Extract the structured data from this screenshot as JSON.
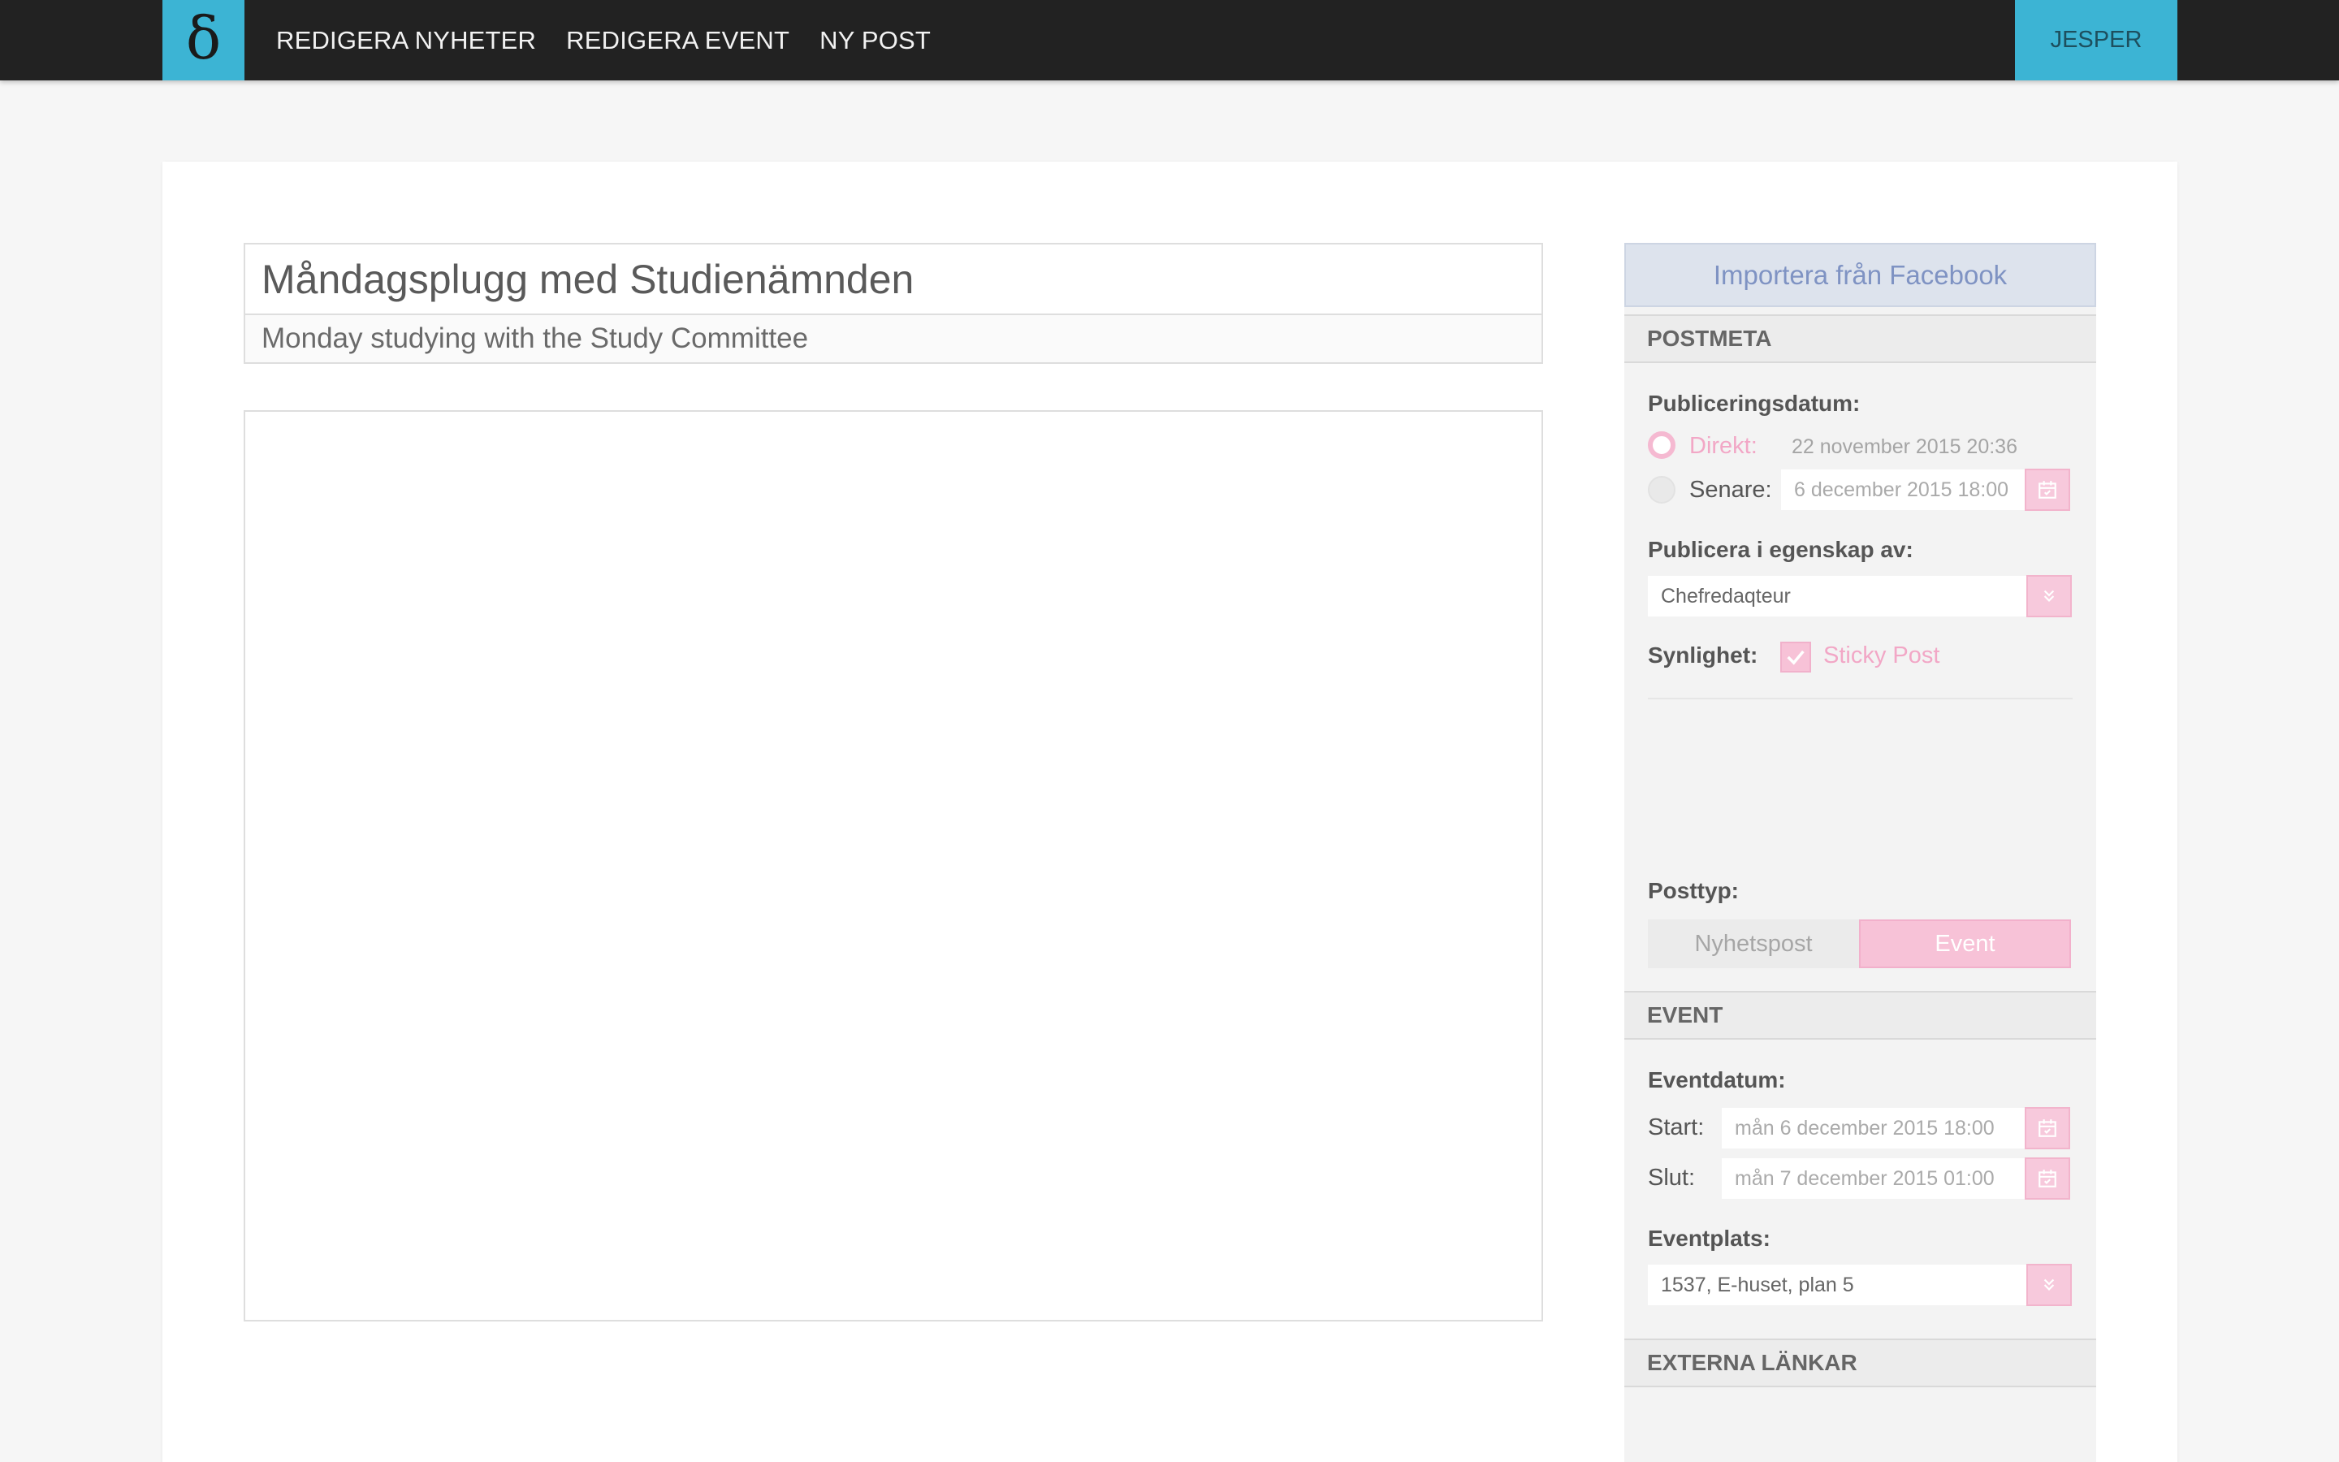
{
  "nav": {
    "logo_glyph": "δ",
    "links": [
      "REDIGERA NYHETER",
      "REDIGERA EVENT",
      "NY POST"
    ],
    "user": "JESPER"
  },
  "editor": {
    "title": "Måndagsplugg med Studienämnden",
    "subtitle": "Monday studying with the Study Committee",
    "body": ""
  },
  "sidebar": {
    "facebook_button": "Importera från Facebook",
    "postmeta": {
      "heading": "POSTMETA",
      "publish_date_label": "Publiceringsdatum:",
      "direct_label": "Direkt:",
      "direct_date": "22 november 2015 20:36",
      "later_label": "Senare:",
      "later_date": "6 december 2015 18:00",
      "publish_as_label": "Publicera i egenskap av:",
      "publish_as_value": "Chefredaqteur",
      "visibility_label": "Synlighet:",
      "sticky_label": "Sticky Post",
      "posttype_label": "Posttyp:",
      "posttype_news": "Nyhetspost",
      "posttype_event": "Event"
    },
    "event": {
      "heading": "EVENT",
      "date_label": "Eventdatum:",
      "start_label": "Start:",
      "start_value": "mån 6 december 2015 18:00",
      "end_label": "Slut:",
      "end_value": "mån 7 december 2015 01:00",
      "place_label": "Eventplats:",
      "place_value": "1537, E-huset, plan 5"
    },
    "links": {
      "heading": "EXTERNA LÄNKAR"
    }
  },
  "colors": {
    "accent": "#3cb4d4",
    "nav_bg": "#222222",
    "pink": "#f7c2d7",
    "pink_text": "#f2a7c6",
    "facebook": "#7f93c3"
  }
}
